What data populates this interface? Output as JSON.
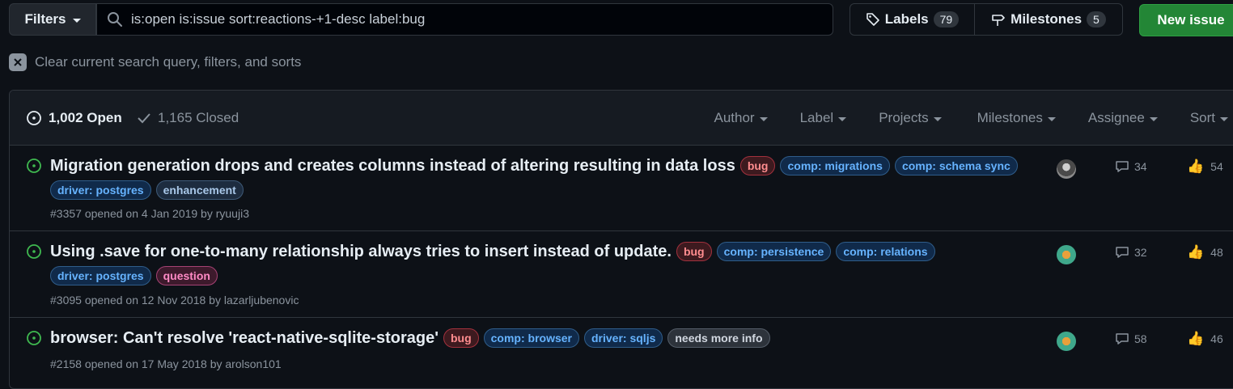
{
  "toolbar": {
    "filters_label": "Filters",
    "search_value": "is:open is:issue sort:reactions-+1-desc label:bug",
    "labels_label": "Labels",
    "labels_count": "79",
    "milestones_label": "Milestones",
    "milestones_count": "5",
    "new_issue_label": "New issue"
  },
  "clear": {
    "label": "Clear current search query, filters, and sorts"
  },
  "header": {
    "open_label": "1,002 Open",
    "closed_label": "1,165 Closed",
    "menus": [
      "Author",
      "Label",
      "Projects",
      "Milestones",
      "Assignee",
      "Sort"
    ]
  },
  "issues": [
    {
      "title": "Migration generation drops and creates columns instead of altering resulting in data loss",
      "labels": [
        "bug",
        "comp: migrations",
        "comp: schema sync",
        "driver: postgres",
        "enhancement"
      ],
      "meta": "#3357 opened on 4 Jan 2019 by ryuuji3",
      "comments": "34",
      "reactions": "54"
    },
    {
      "title": "Using .save for one-to-many relationship always tries to insert instead of update.",
      "labels": [
        "bug",
        "comp: persistence",
        "comp: relations",
        "driver: postgres",
        "question"
      ],
      "meta": "#3095 opened on 12 Nov 2018 by lazarljubenovic",
      "comments": "32",
      "reactions": "48"
    },
    {
      "title": "browser: Can't resolve 'react-native-sqlite-storage'",
      "labels": [
        "bug",
        "comp: browser",
        "driver: sqljs",
        "needs more info"
      ],
      "meta": "#2158 opened on 17 May 2018 by arolson101",
      "comments": "58",
      "reactions": "46"
    }
  ],
  "icons": {
    "search": "search-icon",
    "tag": "tag-icon",
    "milestone": "milestone-icon",
    "issue_open": "issue-opened-icon",
    "check": "check-icon",
    "comment": "comment-icon",
    "thumbs_up": "thumbs-up-icon"
  },
  "colors": {
    "background": "#0d1117",
    "green_button": "#238636",
    "open_icon": "#3fb950"
  }
}
